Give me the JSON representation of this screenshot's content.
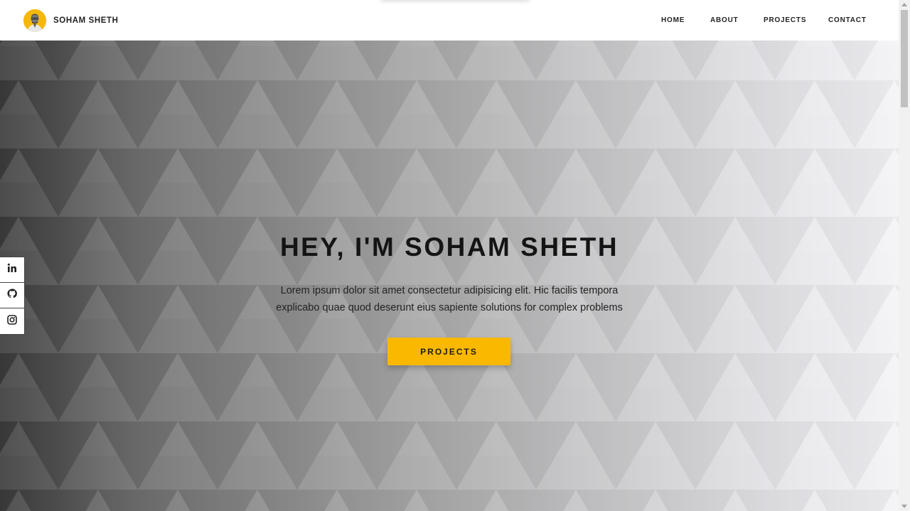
{
  "header": {
    "brand_name": "SOHAM SHETH",
    "nav": {
      "home": "HOME",
      "about": "ABOUT",
      "projects": "PROJECTS",
      "contact": "CONTACT"
    }
  },
  "hero": {
    "title": "HEY, I'M SOHAM SHETH",
    "description": "Lorem ipsum dolor sit amet consectetur adipisicing elit. Hic facilis tempora explicabo quae quod deserunt eius sapiente solutions for complex problems",
    "button_label": "PROJECTS"
  },
  "social": [
    {
      "icon": "linkedin-icon"
    },
    {
      "icon": "github-icon"
    },
    {
      "icon": "instagram-icon"
    }
  ],
  "colors": {
    "accent": "#fbb800",
    "text_dark": "#141414",
    "header_bg": "#ffffff"
  }
}
